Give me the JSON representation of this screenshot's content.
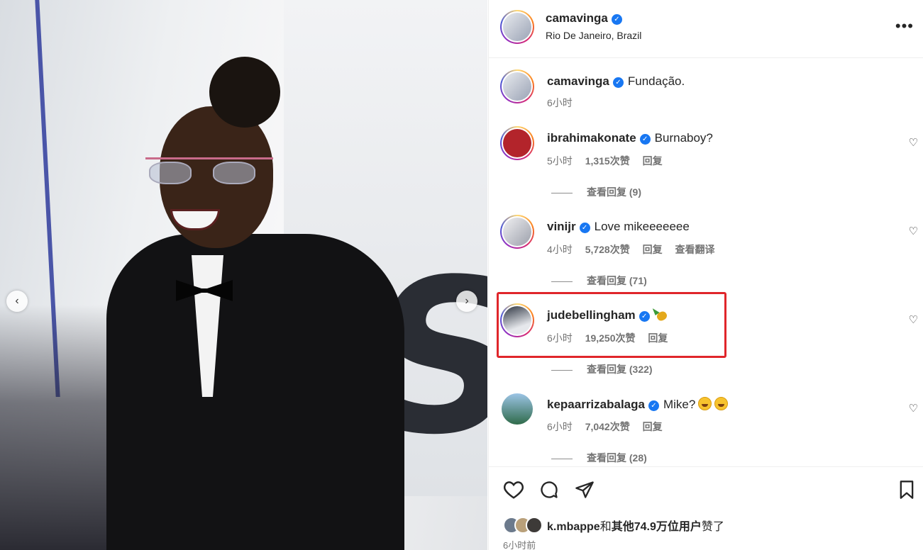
{
  "post": {
    "username": "camavinga",
    "location": "Rio De Janeiro, Brazil",
    "caption": "Fundação.",
    "caption_time": "6小时"
  },
  "comments": [
    {
      "username": "ibrahimakonate",
      "text": "Burnaboy?",
      "time": "5小时",
      "likes": "1,315次赞",
      "reply": "回复",
      "translate": "",
      "view_replies": "查看回复 (9)",
      "avatar_color": "#b3242b"
    },
    {
      "username": "vinijr",
      "text": "Love mikeeeeeee",
      "time": "4小时",
      "likes": "5,728次赞",
      "reply": "回复",
      "translate": "查看翻译",
      "view_replies": "查看回复 (71)",
      "avatar_color": "#c9ccd3"
    },
    {
      "username": "judebellingham",
      "text": "",
      "time": "6小时",
      "likes": "19,250次赞",
      "reply": "回复",
      "translate": "",
      "view_replies": "查看回复 (322)",
      "avatar_color": "#2c3340"
    },
    {
      "username": "kepaarrizabalaga",
      "text": "Mike?",
      "time": "6小时",
      "likes": "7,042次赞",
      "reply": "回复",
      "translate": "",
      "view_replies": "查看回复 (28)",
      "avatar_color": "#2f6b4a"
    }
  ],
  "likes_summary": {
    "user": "k.mbappe",
    "connector": "和",
    "others": "其他74.9万位用户",
    "suffix": "赞了"
  },
  "post_time": "6小时前",
  "icons": [
    "more-icon",
    "verified-icon",
    "heart-icon",
    "comment-icon",
    "share-icon",
    "bookmark-icon",
    "chevron-left-icon",
    "chevron-right-icon"
  ],
  "colors": {
    "verified": "#1877f2",
    "highlight": "#e0262b",
    "muted": "#737373"
  }
}
